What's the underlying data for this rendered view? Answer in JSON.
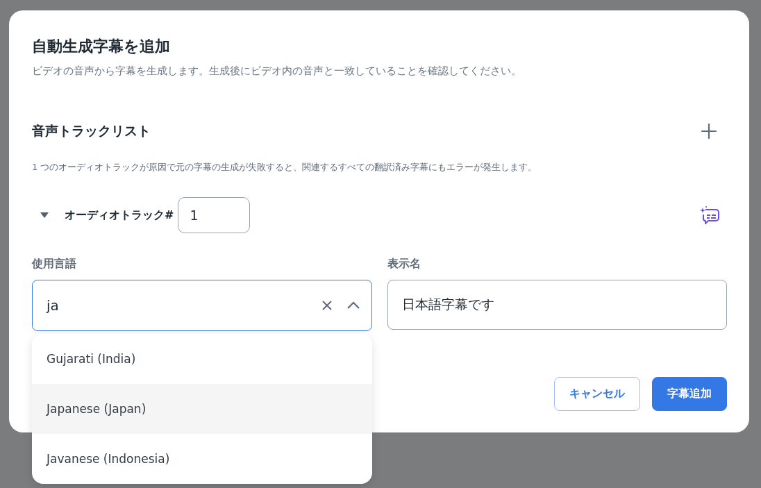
{
  "dialog": {
    "title": "自動生成字幕を追加",
    "description": "ビデオの音声から字幕を生成します。生成後にビデオ内の音声と一致していることを確認してください。"
  },
  "audio_tracks": {
    "heading": "音声トラックリスト",
    "note": "1 つのオーディオトラックが原因で元の字幕の生成が失敗すると、関連するすべての翻訳済み字幕にもエラーが発生します。",
    "tracks": [
      {
        "label": "オーディオトラック#",
        "number": "1",
        "expanded": true,
        "language": {
          "label": "使用言語",
          "value": "ja",
          "open": true,
          "options": [
            {
              "label": "Gujarati (India)",
              "selected": false
            },
            {
              "label": "Japanese (Japan)",
              "selected": true
            },
            {
              "label": "Javanese (Indonesia)",
              "selected": false
            }
          ]
        },
        "display_name": {
          "label": "表示名",
          "value": "日本語字幕です"
        }
      }
    ]
  },
  "buttons": [
    {
      "label": "キャンセル",
      "kind": "secondary"
    },
    {
      "label": "字幕追加",
      "kind": "primary"
    }
  ]
}
